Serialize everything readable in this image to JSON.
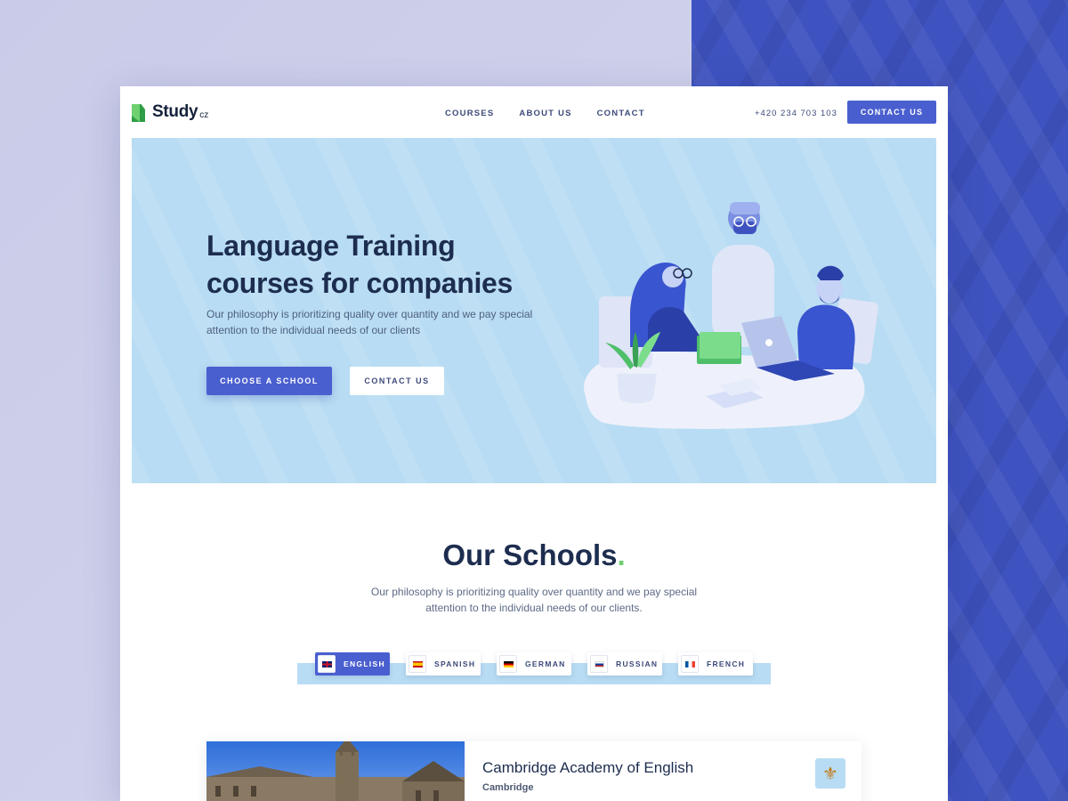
{
  "header": {
    "logo_text": "Study",
    "logo_sub": "cz",
    "nav": [
      "COURSES",
      "ABOUT US",
      "CONTACT"
    ],
    "phone": "+420 234 703 103",
    "cta_label": "CONTACT US"
  },
  "hero": {
    "title_line1": "Language Training",
    "title_line2": "courses for companies",
    "description": "Our philosophy is prioritizing quality over quantity and we pay special attention to the individual needs of our clients",
    "primary_button": "CHOOSE A SCHOOL",
    "secondary_button": "CONTACT US"
  },
  "schools": {
    "title": "Our Schools",
    "title_dot": ".",
    "description": "Our philosophy is prioritizing quality over quantity and we pay special attention to the individual needs of our clients.",
    "tabs": [
      {
        "label": "ENGLISH",
        "flag": "uk-flag-icon",
        "active": true
      },
      {
        "label": "SPANISH",
        "flag": "spain-flag-icon",
        "active": false
      },
      {
        "label": "GERMAN",
        "flag": "germany-flag-icon",
        "active": false
      },
      {
        "label": "RUSSIAN",
        "flag": "russia-flag-icon",
        "active": false
      },
      {
        "label": "FRENCH",
        "flag": "france-flag-icon",
        "active": false
      }
    ]
  },
  "card": {
    "title": "Cambridge Academy of English",
    "city": "Cambridge",
    "badge_icon": "fleur-de-lis-icon"
  },
  "colors": {
    "primary": "#4a5fcf",
    "hero_bg": "#b8dcf3",
    "heading": "#1d2d4f",
    "accent_green": "#6fd06f",
    "outer_right_bg": "#3f53c0"
  }
}
